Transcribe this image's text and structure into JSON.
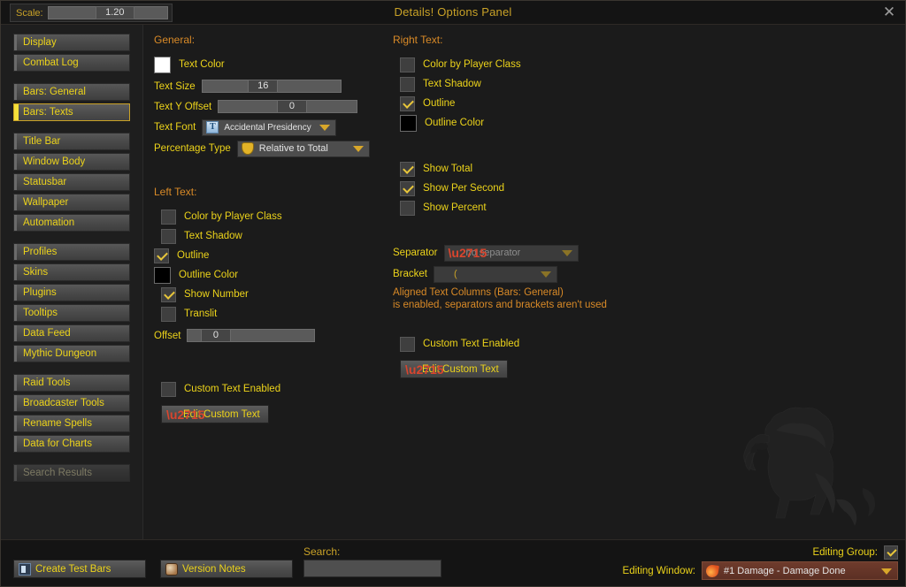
{
  "titlebar": {
    "title": "Details! Options Panel",
    "close_label": "✕",
    "scale_label": "Scale:",
    "scale_value": "1.20"
  },
  "sidebar": {
    "groups": [
      {
        "items": [
          {
            "label": "Display",
            "state": "normal"
          },
          {
            "label": "Combat Log",
            "state": "normal"
          }
        ]
      },
      {
        "items": [
          {
            "label": "Bars: General",
            "state": "normal"
          },
          {
            "label": "Bars: Texts",
            "state": "selected"
          }
        ]
      },
      {
        "items": [
          {
            "label": "Title Bar",
            "state": "normal"
          },
          {
            "label": "Window Body",
            "state": "normal"
          },
          {
            "label": "Statusbar",
            "state": "normal"
          },
          {
            "label": "Wallpaper",
            "state": "normal"
          },
          {
            "label": "Automation",
            "state": "normal"
          }
        ]
      },
      {
        "items": [
          {
            "label": "Profiles",
            "state": "normal"
          },
          {
            "label": "Skins",
            "state": "normal"
          },
          {
            "label": "Plugins",
            "state": "normal"
          },
          {
            "label": "Tooltips",
            "state": "normal"
          },
          {
            "label": "Data Feed",
            "state": "normal"
          },
          {
            "label": "Mythic Dungeon",
            "state": "normal"
          }
        ]
      },
      {
        "items": [
          {
            "label": "Raid Tools",
            "state": "normal"
          },
          {
            "label": "Broadcaster Tools",
            "state": "normal"
          },
          {
            "label": "Rename Spells",
            "state": "normal"
          },
          {
            "label": "Data for Charts",
            "state": "normal"
          }
        ]
      },
      {
        "items": [
          {
            "label": "Search Results",
            "state": "disabled"
          }
        ]
      }
    ]
  },
  "general": {
    "heading": "General:",
    "text_color_label": "Text Color",
    "text_color_value": "#ffffff",
    "text_size_label": "Text Size",
    "text_size_value": "16",
    "text_y_offset_label": "Text Y Offset",
    "text_y_offset_value": "0",
    "text_font_label": "Text Font",
    "text_font_value": "Accidental Presidency",
    "percentage_type_label": "Percentage Type",
    "percentage_type_value": "Relative to Total"
  },
  "left_text": {
    "heading": "Left Text:",
    "color_by_player_class": "Color by Player Class",
    "text_shadow": "Text Shadow",
    "outline": "Outline",
    "outline_color": "Outline Color",
    "outline_color_value": "#000000",
    "show_number": "Show Number",
    "translit": "Translit",
    "offset_label": "Offset",
    "offset_value": "0",
    "custom_text_enabled": "Custom Text Enabled",
    "edit_custom_text": "Edit Custom Text",
    "checks": {
      "color_by_player_class": false,
      "text_shadow": false,
      "outline": true,
      "show_number": true,
      "translit": false,
      "custom_text_enabled": false
    }
  },
  "right_text": {
    "heading": "Right Text:",
    "color_by_player_class": "Color by Player Class",
    "text_shadow": "Text Shadow",
    "outline": "Outline",
    "outline_color": "Outline Color",
    "outline_color_value": "#000000",
    "show_total": "Show Total",
    "show_per_second": "Show Per Second",
    "show_percent": "Show Percent",
    "separator_label": "Separator",
    "separator_value": "no separator",
    "bracket_label": "Bracket",
    "bracket_value": "(",
    "warning_line1": "Aligned Text Columns (Bars: General)",
    "warning_line2": "is enabled, separators and brackets aren't used",
    "custom_text_enabled": "Custom Text Enabled",
    "edit_custom_text": "Edit Custom Text",
    "checks": {
      "color_by_player_class": false,
      "text_shadow": false,
      "outline": true,
      "show_total": true,
      "show_per_second": true,
      "show_percent": false,
      "custom_text_enabled": false
    }
  },
  "footer": {
    "create_test_bars": "Create Test Bars",
    "version_notes": "Version Notes",
    "search_label": "Search:",
    "search_value": "",
    "search_placeholder": "",
    "editing_group_label": "Editing Group:",
    "editing_group_checked": true,
    "editing_window_label": "Editing Window:",
    "editing_window_value": "#1 Damage - Damage Done"
  },
  "colors": {
    "gold": "#ecd31a",
    "title_gold": "#c9a227",
    "orange": "#d98a27",
    "red": "#d9452e",
    "panel_bg": "#1b1b1b"
  }
}
